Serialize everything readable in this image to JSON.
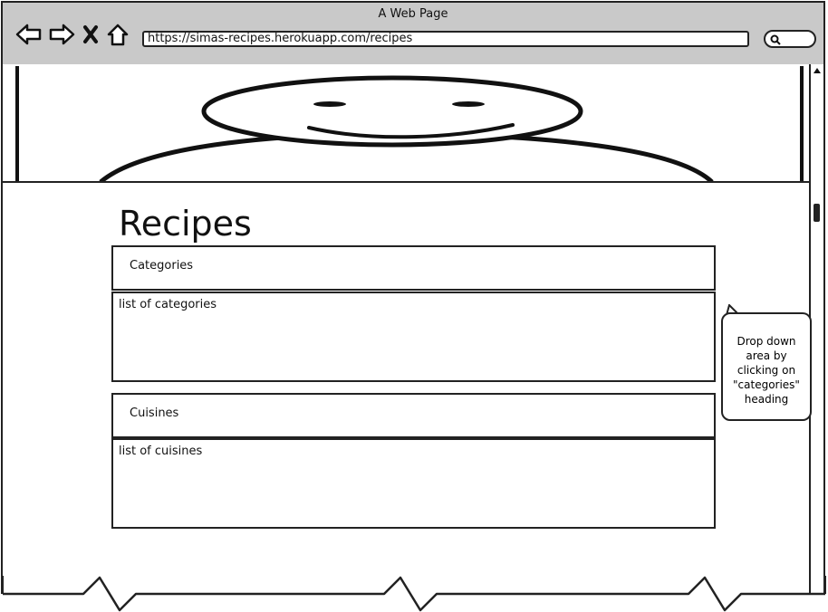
{
  "window": {
    "title": "A Web Page"
  },
  "address_bar": {
    "url": "https://simas-recipes.herokuapp.com/recipes"
  },
  "page": {
    "title": "Recipes"
  },
  "sections": [
    {
      "heading": "Categories",
      "content": "list of categories"
    },
    {
      "heading": "Cuisines",
      "content": "list of cuisines"
    }
  ],
  "annotation": {
    "lines": [
      "Drop down",
      "area by",
      "clicking on",
      "\"categories\"",
      "heading"
    ]
  }
}
